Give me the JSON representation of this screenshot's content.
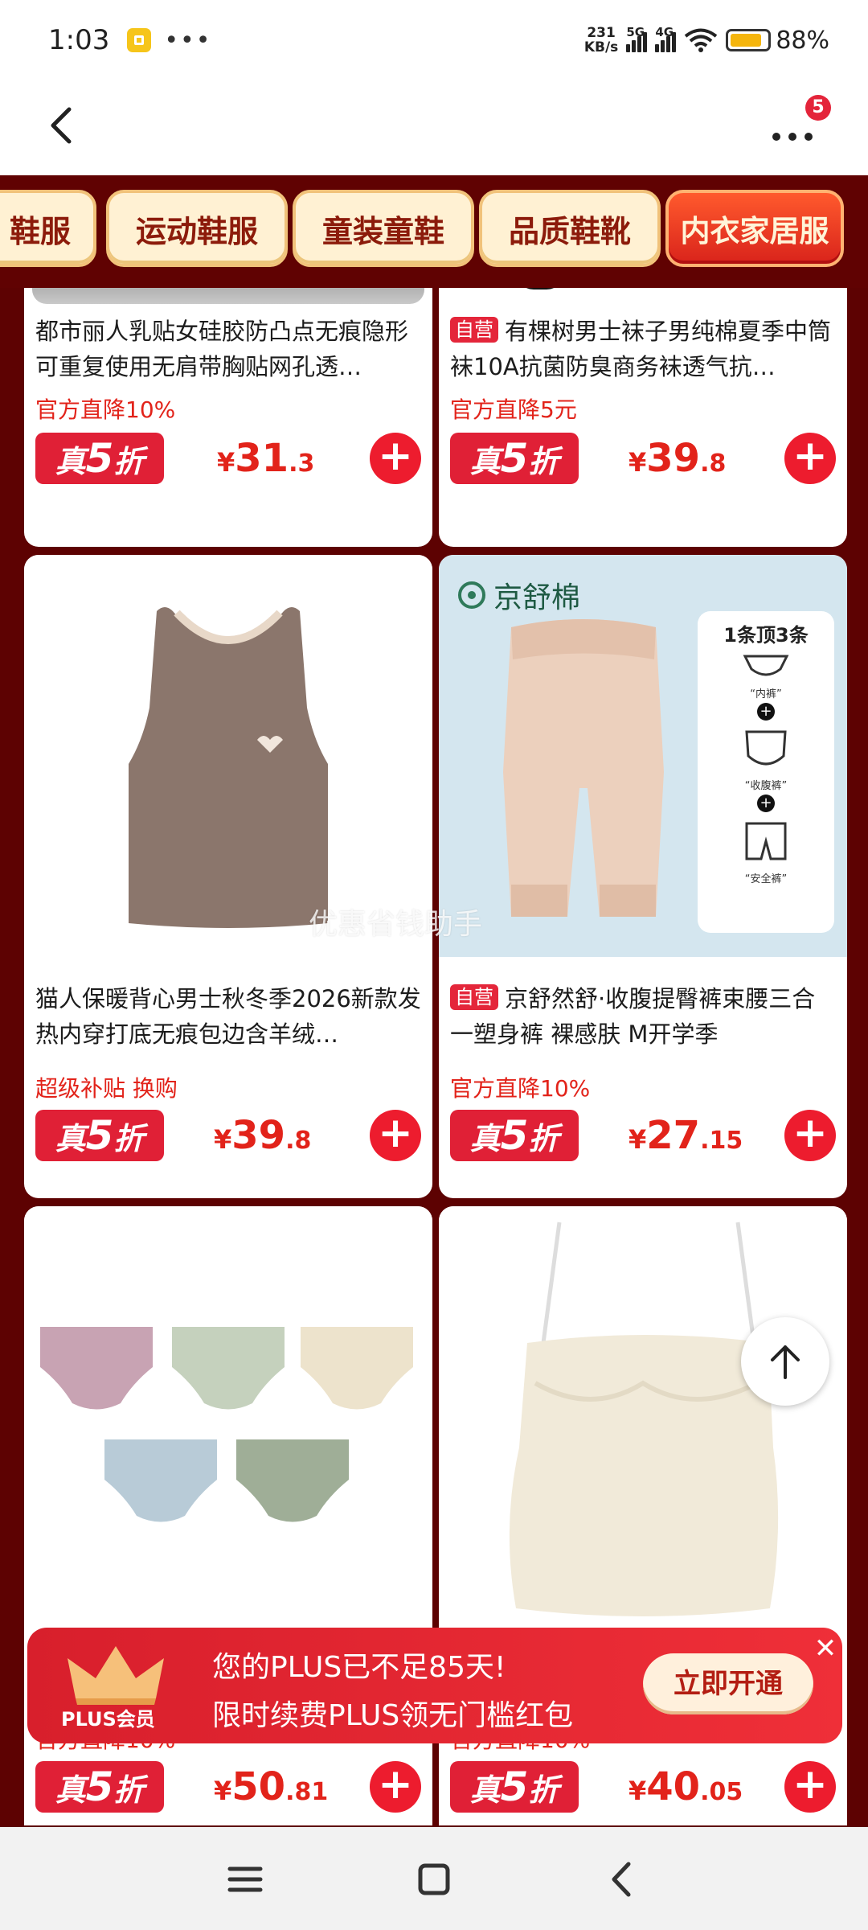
{
  "status_bar": {
    "time": "1:03",
    "more": "•••",
    "net_speed_value": "231",
    "net_speed_unit": "KB/s",
    "sig1_label": "5G",
    "sig2_label": "4G",
    "battery": "88%"
  },
  "header": {
    "badge_count": "5"
  },
  "tabs": [
    {
      "label": "鞋服"
    },
    {
      "label": "运动鞋服"
    },
    {
      "label": "童装童鞋"
    },
    {
      "label": "品质鞋靴"
    },
    {
      "label": "内衣家居服"
    }
  ],
  "products": [
    {
      "title": "都市丽人乳贴女硅胶防凸点无痕隐形可重复使用无肩带胸贴网孔透…",
      "self_run": "",
      "promo": "官方直降10%",
      "discount_prefix": "真",
      "discount_num": "5",
      "discount_suffix": "折",
      "yen": "¥",
      "price_int": "31",
      "price_dec": ".3"
    },
    {
      "title": "有棵树男士袜子男纯棉夏季中筒袜10A抗菌防臭商务袜透气抗…",
      "self_run": "自营",
      "promo": "官方直降5元",
      "discount_prefix": "真",
      "discount_num": "5",
      "discount_suffix": "折",
      "yen": "¥",
      "price_int": "39",
      "price_dec": ".8"
    },
    {
      "title": "猫人保暖背心男士秋冬季2026新款发热内穿打底无痕包边含羊绒…",
      "self_run": "",
      "promo": "超级补贴  换购",
      "discount_prefix": "真",
      "discount_num": "5",
      "discount_suffix": "折",
      "yen": "¥",
      "price_int": "39",
      "price_dec": ".8"
    },
    {
      "title": "京舒然舒·收腹提臀裤束腰三合一塑身裤 裸感肤 M开学季",
      "self_run": "自营",
      "promo": "官方直降10%",
      "discount_prefix": "真",
      "discount_num": "5",
      "discount_suffix": "折",
      "yen": "¥",
      "price_int": "27",
      "price_dec": ".15",
      "image_text": {
        "brand": "京舒棉",
        "headline": "1条顶3条",
        "item1": "“内裤”",
        "item2": "“收腹裤”",
        "item3": "“安全裤”"
      }
    },
    {
      "title": "",
      "self_run": "",
      "promo": "官方直降10%",
      "discount_prefix": "真",
      "discount_num": "5",
      "discount_suffix": "折",
      "yen": "¥",
      "price_int": "50",
      "price_dec": ".81"
    },
    {
      "title": "",
      "self_run": "",
      "promo": "官方直降10%",
      "discount_prefix": "真",
      "discount_num": "5",
      "discount_suffix": "折",
      "yen": "¥",
      "price_int": "40",
      "price_dec": ".05"
    }
  ],
  "watermark": "优惠省钱助手",
  "plus_banner": {
    "label": "PLUS会员",
    "line1": "您的PLUS已不足85天!",
    "line2": "限时续费PLUS领无门槛红包",
    "button": "立即开通",
    "close": "✕"
  },
  "colors": {
    "accent_red": "#e2231a",
    "page_bg": "#5d0202",
    "tab_bg": "#fff1d3"
  }
}
